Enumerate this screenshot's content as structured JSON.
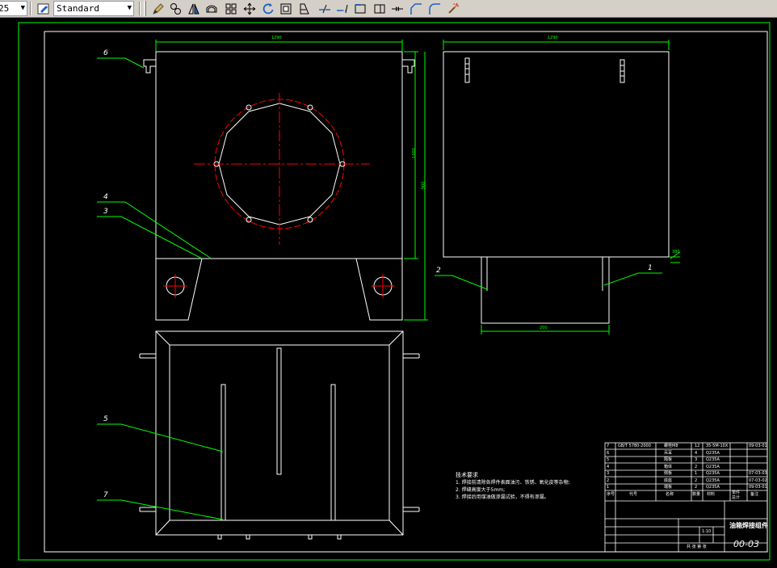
{
  "toolbar": {
    "dimstyle_value": "25",
    "textstyle_value": "Standard",
    "icons": [
      "text-style-icon",
      "pencil-icon",
      "copy-object-icon",
      "mirror-icon",
      "offset-icon",
      "array-icon",
      "move-icon",
      "rotate-icon",
      "scale-icon",
      "stretch-icon",
      "trim-icon",
      "extend-icon",
      "break-icon",
      "join-icon",
      "break-at-point-icon",
      "chamfer-icon",
      "fillet-icon",
      "explode-icon"
    ]
  },
  "drawing": {
    "part_labels": [
      "6",
      "4",
      "3",
      "5",
      "7",
      "2",
      "1"
    ],
    "dimension_texts": [
      "1290",
      "1000",
      "200",
      "900",
      "1290",
      "380"
    ],
    "notes": {
      "title": "技术要求",
      "lines": [
        "1. 焊接前清除各焊件表面油污、铁锈、氧化皮等杂物;",
        "2. 焊缝高度大于5mm;",
        "3. 焊接后用煤油做渗漏试验，不得有渗漏。"
      ]
    },
    "title_block": {
      "bom_rows": [
        {
          "no": "7",
          "code": "GB/T 5780-2000",
          "name": "螺栓M8",
          "qty": "12",
          "material": "35-5M-10X",
          "note": "09-03-01"
        },
        {
          "no": "6",
          "code": "",
          "name": "吊耳",
          "qty": "4",
          "material": "Q235A",
          "note": ""
        },
        {
          "no": "5",
          "code": "",
          "name": "隔板",
          "qty": "3",
          "material": "Q235A",
          "note": ""
        },
        {
          "no": "4",
          "code": "",
          "name": "箱体",
          "qty": "2",
          "material": "Q235A",
          "note": ""
        },
        {
          "no": "3",
          "code": "",
          "name": "侧板",
          "qty": "1",
          "material": "Q235A",
          "note": "07-03-03"
        },
        {
          "no": "2",
          "code": "",
          "name": "底座",
          "qty": "2",
          "material": "Q235A",
          "note": "07-03-02"
        },
        {
          "no": "1",
          "code": "",
          "name": "端板",
          "qty": "2",
          "material": "Q235A",
          "note": "09-03-01"
        }
      ],
      "header": [
        "序号",
        "代号",
        "名称",
        "数量",
        "材料",
        "单件",
        "总计",
        "备注"
      ],
      "product_name": "油箱焊接组件",
      "drawing_no": "00-03",
      "scale": "1:10",
      "sheet": "共 张 第 张"
    }
  },
  "colors": {
    "drawing_bg": "#000000",
    "geometry": "#ffffff",
    "frame": "#00ff00",
    "centerline": "#ff0000",
    "leader": "#00ff00",
    "toolbar_bg": "#d4d0c8"
  }
}
